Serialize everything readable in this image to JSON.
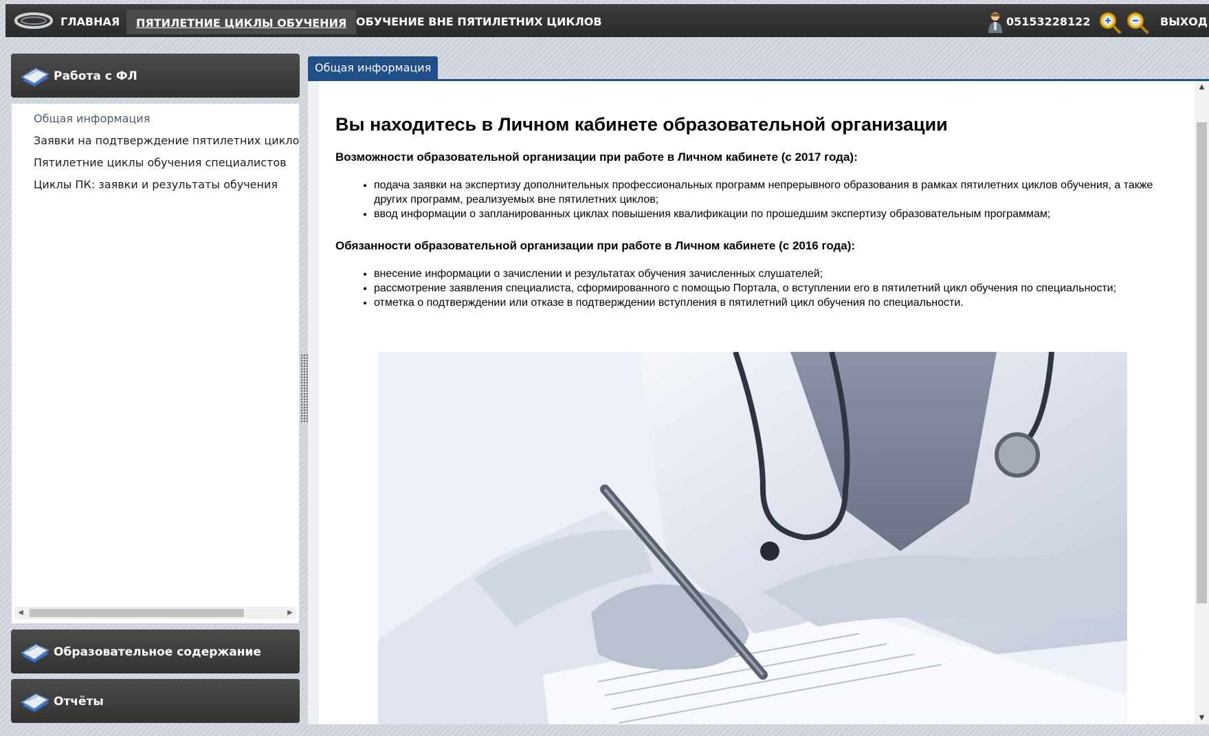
{
  "topbar": {
    "logo_icon": "ring-logo-icon",
    "nav": {
      "home": "ГЛАВНАЯ",
      "five_year_cycles": "ПЯТИЛЕТНИЕ ЦИКЛЫ ОБУЧЕНИЯ",
      "outside_cycles": "ОБУЧЕНИЕ ВНЕ ПЯТИЛЕТНИХ ЦИКЛОВ"
    },
    "user_icon": "user-icon",
    "user_id": "05153228122",
    "zoom_in_icon": "zoom-in-icon",
    "zoom_out_icon": "zoom-out-icon",
    "logout": "ВЫХОД"
  },
  "sidebar": {
    "panels": [
      {
        "label": "Работа с ФЛ",
        "icon": "book-icon"
      },
      {
        "label": "Образовательное содержание",
        "icon": "book-icon"
      },
      {
        "label": "Отчёты",
        "icon": "book-icon"
      }
    ],
    "items": [
      {
        "label": "Общая информация",
        "active": true
      },
      {
        "label": "Заявки на подтверждение пятилетних циклов",
        "active": false
      },
      {
        "label": "Пятилетние циклы обучения специалистов",
        "active": false
      },
      {
        "label": "Циклы ПК: заявки и результаты обучения",
        "active": false
      }
    ]
  },
  "main": {
    "tab": "Общая информация",
    "heading": "Вы находитесь в Личном кабинете образовательной организации",
    "capabilities_title": "Возможности образовательной организации при работе в Личном кабинете (с 2017 года):",
    "capabilities": [
      "подача заявки на экспертизу дополнительных профессиональных программ непрерывного образования в рамках пятилетних циклов обучения, а также других программ, реализуемых вне пятилетних циклов;",
      "ввод информации о запланированных циклах повышения квалификации по прошедшим экспертизу образовательным программам;"
    ],
    "duties_title": "Обязанности образовательной организации при работе в Личном кабинете (с 2016 года):",
    "duties": [
      "внесение информации о зачислении и результатах обучения зачисленных слушателей;",
      "рассмотрение заявления специалиста, сформированного с помощью Портала, о вступлении его в пятилетний цикл обучения по специальности;",
      "отметка о подтверждении или отказе в подтверждении вступления в пятилетний цикл обучения по специальности."
    ]
  },
  "colors": {
    "topbar": "#2f2f2f",
    "tab_accent": "#1f4f86",
    "panel_header": "#3d3d3d"
  }
}
